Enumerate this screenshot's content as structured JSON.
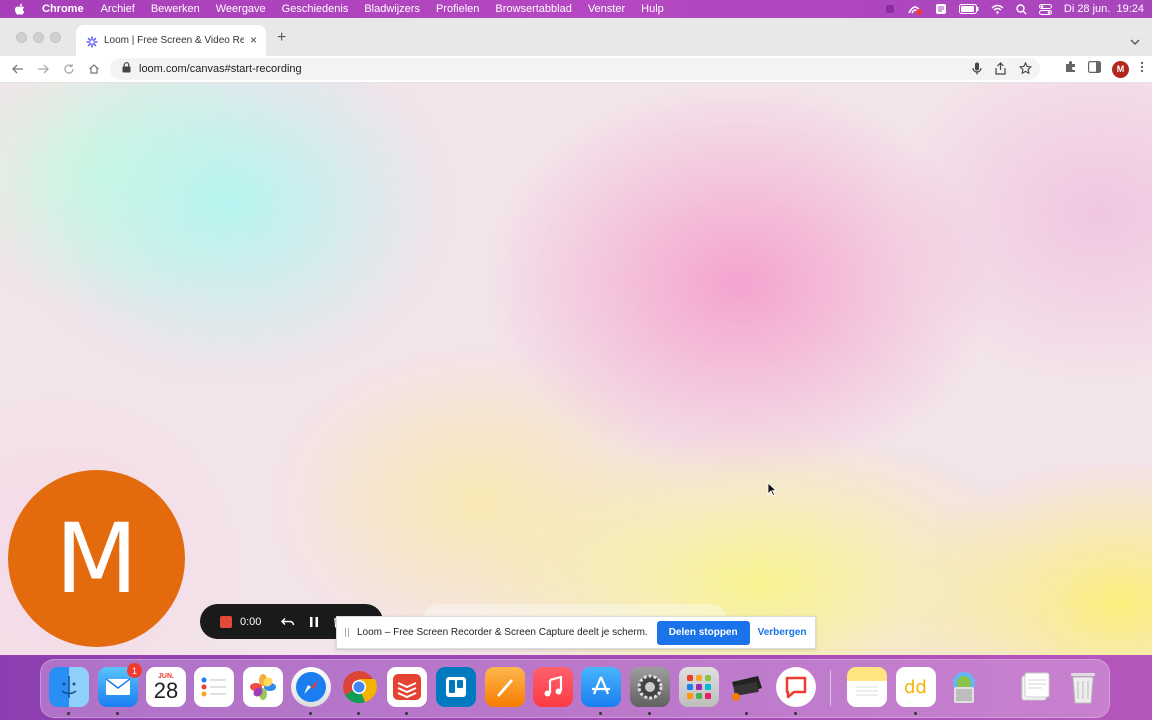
{
  "menubar": {
    "app_name": "Chrome",
    "items": [
      "Archief",
      "Bewerken",
      "Weergave",
      "Geschiedenis",
      "Bladwijzers",
      "Profielen",
      "Browsertabblad",
      "Venster",
      "Hulp"
    ],
    "clock": "Di 28 jun.  19:24"
  },
  "tab": {
    "title": "Loom | Free Screen & Video Re",
    "close": "×"
  },
  "toolbar": {
    "url": "loom.com/canvas#start-recording",
    "profile_initial": "M"
  },
  "camera": {
    "initial": "M"
  },
  "recorder": {
    "time": "0:00"
  },
  "share_bar": {
    "text": "Loom – Free Screen Recorder & Screen Capture deelt je scherm.",
    "stop_label": "Delen stoppen",
    "hide_label": "Verbergen"
  },
  "dock": {
    "mail_badge": "1",
    "calendar_month": "JUN.",
    "calendar_day": "28"
  },
  "colors": {
    "menubar": "#a846bc",
    "accent_blue": "#1a73e8",
    "camera_bubble": "#e36a0d",
    "recorder_stop": "#e34a3a"
  }
}
